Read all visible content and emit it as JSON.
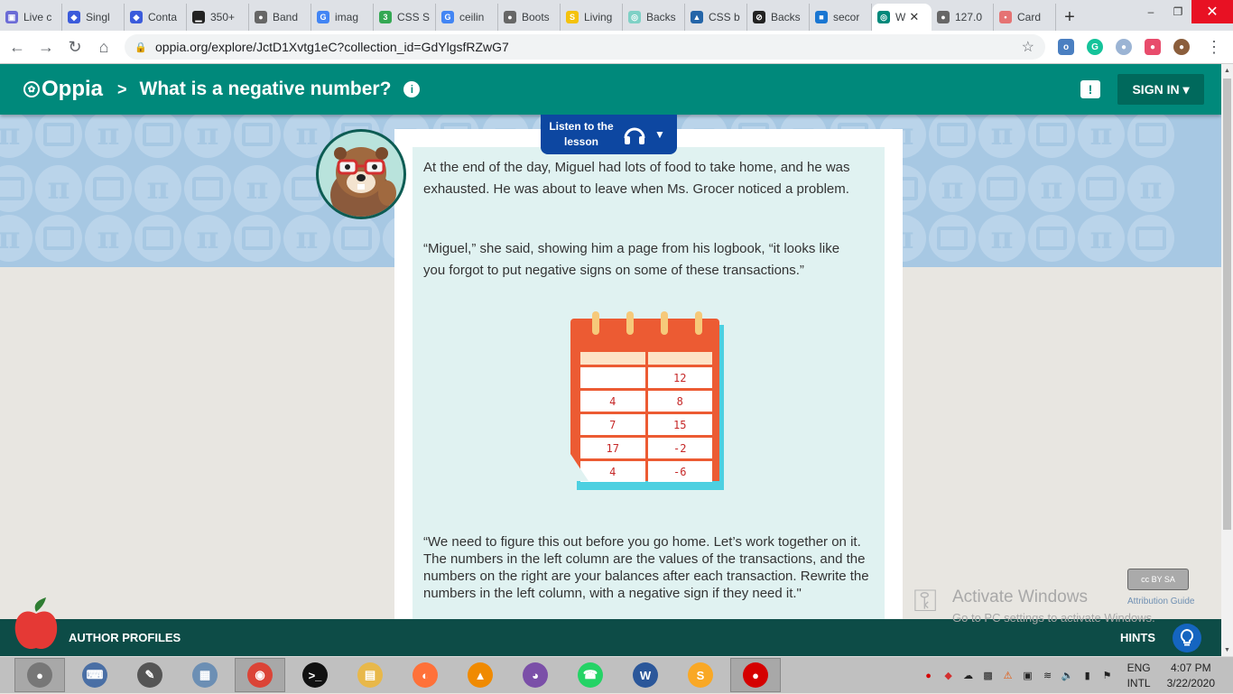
{
  "browser": {
    "tabs": [
      {
        "title": "Live c",
        "color": "#6b6bd6",
        "glyph": "▣"
      },
      {
        "title": "Singl",
        "color": "#3b5bdb",
        "glyph": "◆"
      },
      {
        "title": "Conta",
        "color": "#3b5bdb",
        "glyph": "◆"
      },
      {
        "title": "350+",
        "color": "#222222",
        "glyph": "▁"
      },
      {
        "title": "Band",
        "color": "#666666",
        "glyph": "●"
      },
      {
        "title": "imag",
        "color": "#4285f4",
        "glyph": "G"
      },
      {
        "title": "CSS S",
        "color": "#34a853",
        "glyph": "3"
      },
      {
        "title": "ceilin",
        "color": "#4285f4",
        "glyph": "G"
      },
      {
        "title": "Boots",
        "color": "#666666",
        "glyph": "●"
      },
      {
        "title": "Living",
        "color": "#f4c20d",
        "glyph": "S"
      },
      {
        "title": "Backs",
        "color": "#7fd1c6",
        "glyph": "◎"
      },
      {
        "title": "CSS b",
        "color": "#2465a8",
        "glyph": "▲"
      },
      {
        "title": "Backs",
        "color": "#222222",
        "glyph": "⊘"
      },
      {
        "title": "secor",
        "color": "#1976d2",
        "glyph": "■"
      },
      {
        "title": "W",
        "color": "#00897b",
        "glyph": "◎",
        "active": true
      },
      {
        "title": "127.0",
        "color": "#666666",
        "glyph": "●"
      },
      {
        "title": "Card",
        "color": "#e57373",
        "glyph": "•"
      }
    ],
    "new_tab": "+",
    "url": "oppia.org/explore/JctD1Xvtg1eC?collection_id=GdYlgsfRZwG7",
    "window_controls": {
      "minimize": "–",
      "maximize": "❐",
      "close": "✕"
    }
  },
  "header": {
    "logo_text": "Oppia",
    "separator": ">",
    "title": "What is a negative number?",
    "info_glyph": "i",
    "signin_label": "SIGN IN ▾"
  },
  "audio": {
    "label": "Listen to the lesson",
    "icon": "headphones-icon",
    "dropdown": "▼"
  },
  "lesson": {
    "paragraph1": "At the end of the day, Miguel had lots of food to take home, and he was exhausted. He was about to leave when Ms. Grocer noticed a problem.",
    "paragraph2": "“Miguel,” she said, showing him a page from his logbook, “it looks like you forgot to put negative signs on some of these transactions.”",
    "logbook_rows": [
      [
        "",
        "12"
      ],
      [
        "4",
        "8"
      ],
      [
        "7",
        "15"
      ],
      [
        "17",
        "-2"
      ],
      [
        "4",
        "-6"
      ]
    ],
    "paragraph3": "“We need to figure this out before you go home. Let’s work together on it. The numbers in the left column are the values of the transactions, and the numbers on the right are your balances after each transaction. Rewrite the numbers in the left column, with a negative sign if they need it.\""
  },
  "footer": {
    "author_profiles": "AUTHOR PROFILES",
    "hints": "HINTS",
    "cc_label": "cc BY SA",
    "attribution_guide": "Attribution Guide"
  },
  "watermark": {
    "line1": "Activate Windows",
    "line2": "Go to PC settings to activate Windows."
  },
  "taskbar": {
    "apps": [
      {
        "name": "start-icon",
        "color": "#777777",
        "glyph": "●",
        "pressed": true
      },
      {
        "name": "keyboard-icon",
        "color": "#4a6fa5",
        "glyph": "⌨"
      },
      {
        "name": "pen-icon",
        "color": "#555555",
        "glyph": "✎"
      },
      {
        "name": "calculator-icon",
        "color": "#6c8fb4",
        "glyph": "▦"
      },
      {
        "name": "chrome-icon",
        "color": "#db4437",
        "glyph": "◉",
        "pressed": true
      },
      {
        "name": "terminal-icon",
        "color": "#111111",
        "glyph": ">_"
      },
      {
        "name": "file-explorer-icon",
        "color": "#e8b84a",
        "glyph": "▤"
      },
      {
        "name": "firefox-icon",
        "color": "#ff7139",
        "glyph": "◐"
      },
      {
        "name": "vlc-icon",
        "color": "#f08a00",
        "glyph": "▲"
      },
      {
        "name": "github-icon",
        "color": "#7b4fa8",
        "glyph": "◕"
      },
      {
        "name": "whatsapp-icon",
        "color": "#25d366",
        "glyph": "☎"
      },
      {
        "name": "word-icon",
        "color": "#2b579a",
        "glyph": "W"
      },
      {
        "name": "sublime-icon",
        "color": "#f9a825",
        "glyph": "S"
      },
      {
        "name": "record-icon",
        "color": "#d50000",
        "glyph": "●",
        "pressed": true
      }
    ],
    "lang_top": "ENG",
    "lang_bottom": "INTL",
    "time": "4:07 PM",
    "date": "3/22/2020"
  }
}
